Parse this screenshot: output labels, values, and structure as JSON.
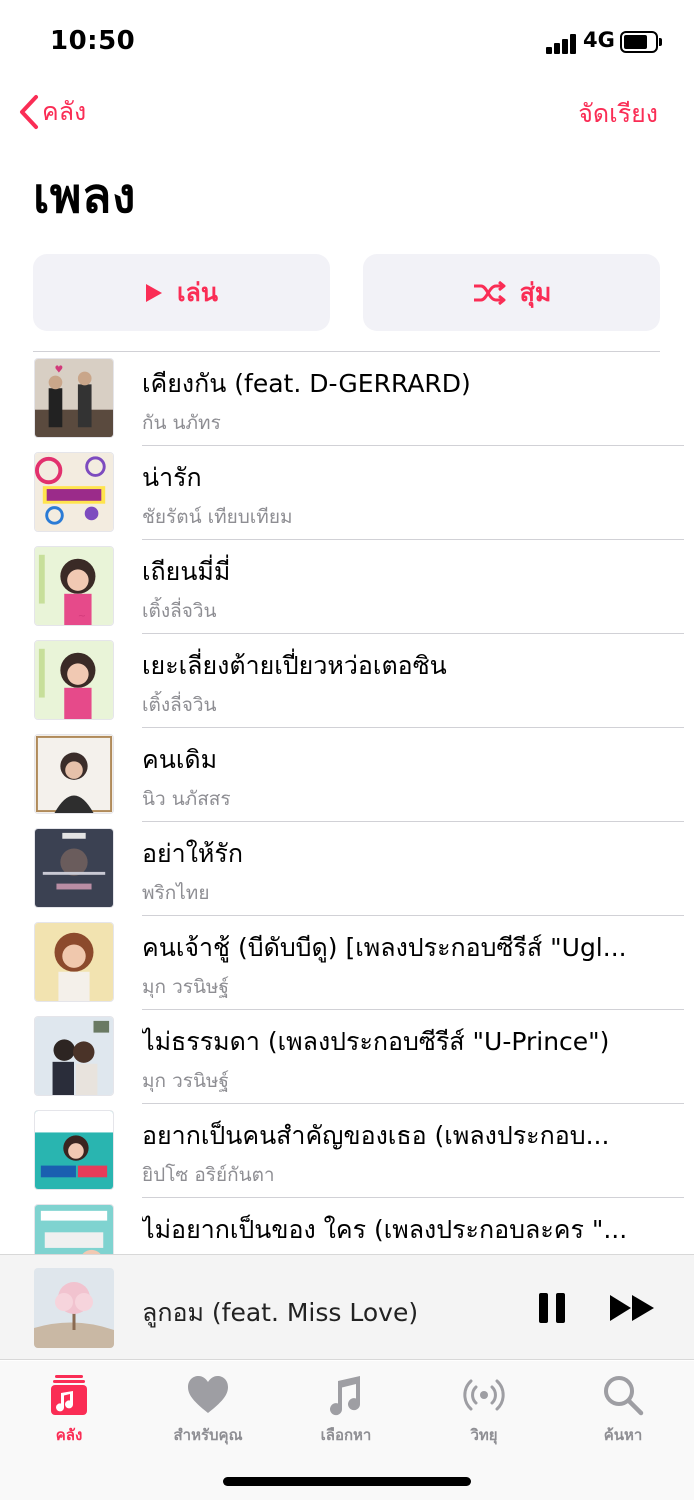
{
  "status_bar": {
    "time": "10:50",
    "network": "4G",
    "battery_level": 0.75
  },
  "nav": {
    "back_label": "คลัง",
    "sort_label": "จัดเรียง"
  },
  "page_title": "เพลง",
  "actions": {
    "play_label": "เล่น",
    "shuffle_label": "สุ่ม"
  },
  "songs": [
    {
      "title": "เคียงกัน (feat. D-GERRARD)",
      "artist": "กัน นภัทร"
    },
    {
      "title": "น่ารัก",
      "artist": "ชัยรัตน์ เทียบเทียม"
    },
    {
      "title": "เถียนมี่มี่",
      "artist": "เติ้งลี่จวิน"
    },
    {
      "title": "เยะเลี่ยงต้ายเปี่ยวหว่อเตอซิน",
      "artist": "เติ้งลี่จวิน"
    },
    {
      "title": "คนเดิม",
      "artist": "นิว นภัสสร"
    },
    {
      "title": "อย่าให้รัก",
      "artist": "พริกไทย"
    },
    {
      "title": "คนเจ้าชู้ (บีดับบีดู) [เพลงประกอบซีรีส์ \"Ugl...",
      "artist": "มุก วรนิษฐ์"
    },
    {
      "title": "ไม่ธรรมดา (เพลงประกอบซีรีส์ \"U-Prince\")",
      "artist": "มุก วรนิษฐ์"
    },
    {
      "title": "อยากเป็นคนสำคัญของเธอ (เพลงประกอบ...",
      "artist": "ยิปโซ อริย์กันตา"
    },
    {
      "title": "ไม่อยากเป็นของ ใคร (เพลงประกอบละคร \"...",
      "artist": ""
    }
  ],
  "mini_player": {
    "title": "ลูกอม (feat. Miss Love)"
  },
  "tabs": [
    {
      "label": "คลัง",
      "icon": "library-icon",
      "active": true
    },
    {
      "label": "สำหรับคุณ",
      "icon": "heart-icon",
      "active": false
    },
    {
      "label": "เลือกหา",
      "icon": "music-note-icon",
      "active": false
    },
    {
      "label": "วิทยุ",
      "icon": "radio-icon",
      "active": false
    },
    {
      "label": "ค้นหา",
      "icon": "search-icon",
      "active": false
    }
  ],
  "colors": {
    "accent": "#fa2d55",
    "secondary_text": "#8e8e93",
    "button_bg": "#f2f2f7"
  }
}
